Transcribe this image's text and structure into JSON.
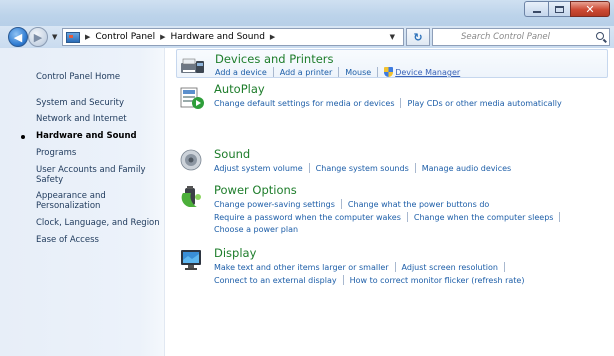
{
  "window": {
    "caption_buttons": [
      "minimize",
      "maximize",
      "close"
    ]
  },
  "navigation": {
    "breadcrumbs": [
      "Control Panel",
      "Hardware and Sound"
    ],
    "search_placeholder": "Search Control Panel"
  },
  "sidebar": {
    "items": [
      {
        "label": "Control Panel Home",
        "active": false
      },
      {
        "label": "System and Security",
        "active": false
      },
      {
        "label": "Network and Internet",
        "active": false
      },
      {
        "label": "Hardware and Sound",
        "active": true
      },
      {
        "label": "Programs",
        "active": false
      },
      {
        "label": "User Accounts and Family Safety",
        "active": false
      },
      {
        "label": "Appearance and Personalization",
        "active": false
      },
      {
        "label": "Clock, Language, and Region",
        "active": false
      },
      {
        "label": "Ease of Access",
        "active": false
      }
    ]
  },
  "categories": [
    {
      "title": "Devices and Printers",
      "icon": "devices-printers-icon",
      "lines": [
        [
          "Add a device",
          "Add a printer",
          "Mouse",
          "Device Manager"
        ]
      ]
    },
    {
      "title": "AutoPlay",
      "icon": "autoplay-icon",
      "lines": [
        [
          "Change default settings for media or devices",
          "Play CDs or other media automatically"
        ]
      ]
    },
    {
      "title": "Sound",
      "icon": "speaker-icon",
      "lines": [
        [
          "Adjust system volume",
          "Change system sounds",
          "Manage audio devices"
        ]
      ]
    },
    {
      "title": "Power Options",
      "icon": "power-options-icon",
      "lines": [
        [
          "Change power-saving settings",
          "Change what the power buttons do"
        ],
        [
          "Require a password when the computer wakes",
          "Change when the computer sleeps"
        ],
        [
          "Choose a power plan"
        ]
      ]
    },
    {
      "title": "Display",
      "icon": "display-icon",
      "lines": [
        [
          "Make text and other items larger or smaller",
          "Adjust screen resolution"
        ],
        [
          "Connect to an external display",
          "How to correct monitor flicker (refresh rate)"
        ]
      ]
    }
  ],
  "colors": {
    "category_title": "#1e7d2b",
    "link": "#1d5ea8",
    "sidebar_text": "#1e395b"
  }
}
